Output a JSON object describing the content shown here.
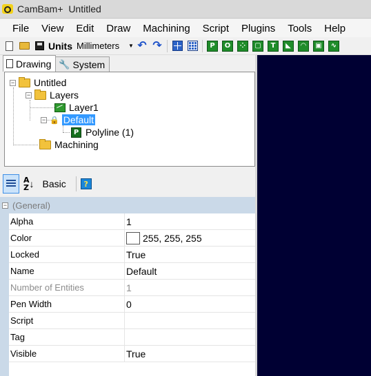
{
  "window": {
    "app_name": "CamBam+",
    "document_name": "Untitled"
  },
  "menu": [
    "File",
    "View",
    "Edit",
    "Draw",
    "Machining",
    "Script",
    "Plugins",
    "Tools",
    "Help"
  ],
  "toolbar": {
    "units_label": "Units",
    "units_value": "Millimeters",
    "green_buttons": [
      "P",
      "O",
      "",
      "",
      "T",
      "",
      "",
      "",
      ""
    ]
  },
  "tabs": [
    {
      "label": "Drawing",
      "icon": "page-icon",
      "active": true
    },
    {
      "label": "System",
      "icon": "wrench-icon",
      "active": false
    }
  ],
  "tree": {
    "root": "Untitled",
    "layers": "Layers",
    "layer1": "Layer1",
    "default_layer": "Default",
    "polyline": "Polyline (1)",
    "machining": "Machining"
  },
  "property_toolbar": {
    "basic_label": "Basic",
    "help_glyph": "?"
  },
  "properties": {
    "category": "(General)",
    "rows": [
      {
        "name": "Alpha",
        "value": "1",
        "readonly": false
      },
      {
        "name": "Color",
        "value": "255, 255, 255",
        "readonly": false,
        "swatch": "#ffffff"
      },
      {
        "name": "Locked",
        "value": "True",
        "readonly": false
      },
      {
        "name": "Name",
        "value": "Default",
        "readonly": false
      },
      {
        "name": "Number of Entities",
        "value": "1",
        "readonly": true
      },
      {
        "name": "Pen Width",
        "value": "0",
        "readonly": false
      },
      {
        "name": "Script",
        "value": "",
        "readonly": false
      },
      {
        "name": "Tag",
        "value": "",
        "readonly": false
      },
      {
        "name": "Visible",
        "value": "True",
        "readonly": false
      }
    ]
  },
  "colors": {
    "canvas": "#000033",
    "selection": "#3399ff",
    "category_band": "#cad9e8",
    "layer_green": "#2f9a2f"
  }
}
